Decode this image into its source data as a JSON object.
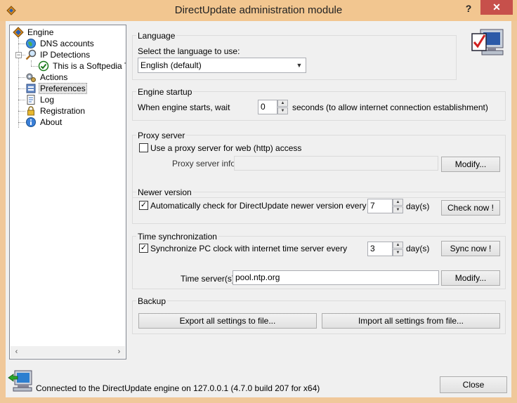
{
  "window": {
    "title": "DirectUpdate administration module",
    "help": "?",
    "close": "✕"
  },
  "tree": {
    "items": [
      {
        "label": "Engine"
      },
      {
        "label": "DNS accounts"
      },
      {
        "label": "IP Detections"
      },
      {
        "label": "This is a Softpedia Te"
      },
      {
        "label": "Actions"
      },
      {
        "label": "Preferences"
      },
      {
        "label": "Log"
      },
      {
        "label": "Registration"
      },
      {
        "label": "About"
      }
    ],
    "selected": "Preferences"
  },
  "language": {
    "group_title": "Language",
    "prompt": "Select the language to use:",
    "selected": "English (default)"
  },
  "startup": {
    "group_title": "Engine startup",
    "label": "When engine starts, wait",
    "value": "0",
    "suffix": "seconds (to allow internet connection establishment)"
  },
  "proxy": {
    "group_title": "Proxy server",
    "checkbox_label": "Use a proxy server for web (http) access",
    "checked": false,
    "info_label": "Proxy server info:",
    "info_value": "",
    "modify": "Modify..."
  },
  "newer": {
    "group_title": "Newer version",
    "checkbox_label": "Automatically check for DirectUpdate newer version every",
    "checked": true,
    "value": "7",
    "unit": "day(s)",
    "button": "Check now !"
  },
  "timesync": {
    "group_title": "Time synchronization",
    "checkbox_label": "Synchronize PC clock with internet time server every",
    "checked": true,
    "value": "3",
    "unit": "day(s)",
    "button": "Sync now !",
    "server_label": "Time server(s):",
    "server_value": "pool.ntp.org",
    "modify": "Modify..."
  },
  "backup": {
    "group_title": "Backup",
    "export": "Export all settings to file...",
    "import": "Import all settings from file..."
  },
  "status": {
    "text": "Connected to the DirectUpdate engine on 127.0.0.1 (4.7.0 build 207 for x64)",
    "close": "Close"
  },
  "colors": {
    "titlebar": "#f2c690",
    "close": "#c7504b",
    "check": "#1a7a1a"
  }
}
